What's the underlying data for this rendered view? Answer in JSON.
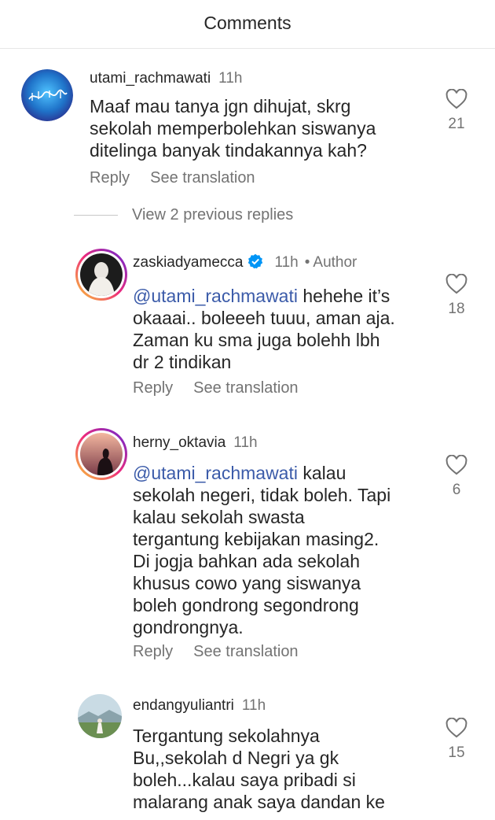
{
  "header": {
    "title": "Comments"
  },
  "view_previous_replies": "View 2 previous replies",
  "comments": [
    {
      "username": "utami_rachmawati",
      "time": "11h",
      "lines": [
        "Maaf mau tanya jgn dihujat, skrg",
        "sekolah memperbolehkan siswanya",
        "ditelinga banyak tindakannya kah?"
      ],
      "reply_label": "Reply",
      "translate_label": "See translation",
      "likes": "21"
    },
    {
      "username": "zaskiadyamecca",
      "time": "11h",
      "author_dot": "•",
      "author_label": "Author",
      "mention": "@utami_rachmawati",
      "first_line_rest": " hehehe it’s",
      "lines": [
        "okaaai.. boleeeh tuuu, aman aja.",
        "Zaman ku sma juga bolehh lbh",
        "dr 2 tindikan"
      ],
      "reply_label": "Reply",
      "translate_label": "See translation",
      "likes": "18"
    },
    {
      "username": "herny_oktavia",
      "time": "11h",
      "mention": "@utami_rachmawati",
      "first_line_rest": " kalau",
      "lines": [
        "sekolah negeri, tidak boleh. Tapi",
        "kalau sekolah swasta",
        "tergantung kebijakan masing2.",
        "Di jogja bahkan ada sekolah",
        "khusus cowo yang siswanya",
        "boleh gondrong segondrong",
        "gondrongnya."
      ],
      "reply_label": "Reply",
      "translate_label": "See translation",
      "likes": "6"
    },
    {
      "username": "endangyuliantri",
      "time": "11h",
      "lines": [
        "Tergantung sekolahnya",
        "Bu,,sekolah d Negri ya gk",
        "boleh...kalau saya pribadi si",
        "malarang anak saya dandan ke"
      ],
      "likes": "15"
    }
  ]
}
